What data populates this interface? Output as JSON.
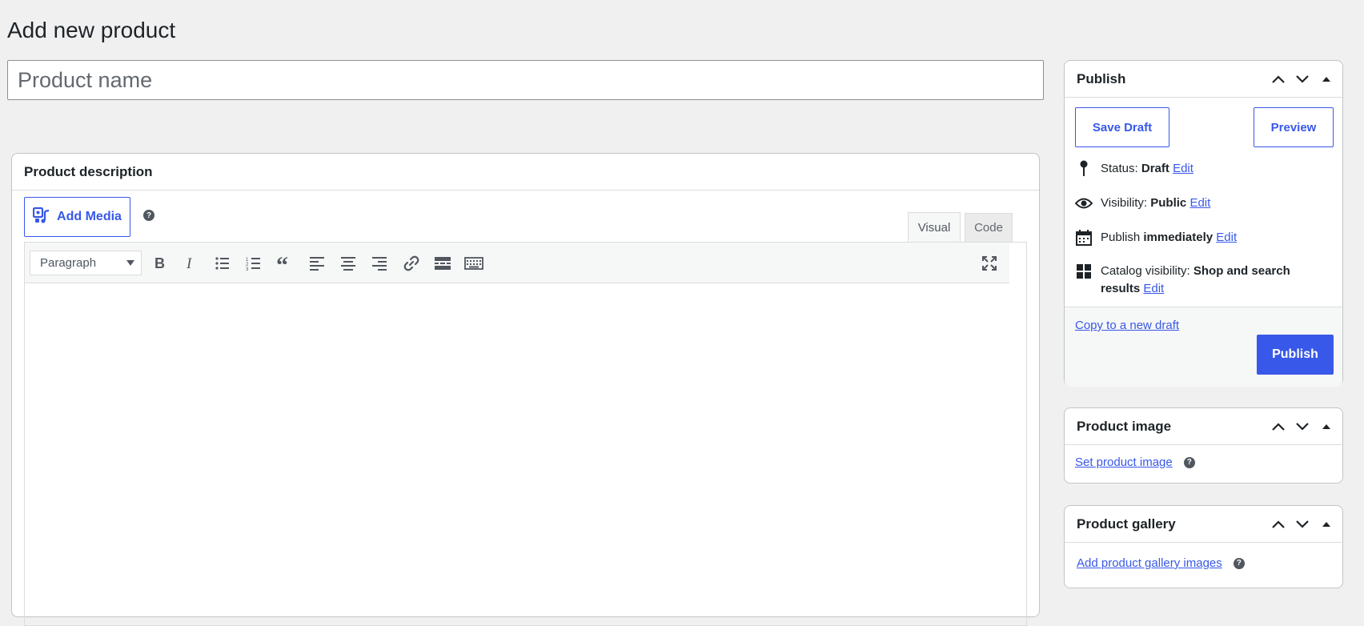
{
  "page": {
    "title": "Add new product"
  },
  "product_name": {
    "placeholder": "Product name",
    "value": ""
  },
  "description": {
    "heading": "Product description",
    "add_media_label": "Add Media",
    "tabs": [
      {
        "label": "Visual",
        "active": true
      },
      {
        "label": "Code",
        "active": false
      }
    ],
    "format_select": "Paragraph",
    "toolbar_icons": [
      "bold-icon",
      "italic-icon",
      "bullet-list-icon",
      "numbered-list-icon",
      "blockquote-icon",
      "align-left-icon",
      "align-center-icon",
      "align-right-icon",
      "link-icon",
      "read-more-icon",
      "toolbar-toggle-icon",
      "fullscreen-icon"
    ]
  },
  "publish": {
    "heading": "Publish",
    "save_draft": "Save Draft",
    "preview": "Preview",
    "status": {
      "label": "Status:",
      "value": "Draft",
      "edit": "Edit"
    },
    "visibility": {
      "label": "Visibility:",
      "value": "Public",
      "edit": "Edit"
    },
    "schedule": {
      "label": "Publish",
      "value": "immediately",
      "edit": "Edit"
    },
    "catalog": {
      "label": "Catalog visibility:",
      "value": "Shop and search results",
      "edit": "Edit"
    },
    "copy_draft": "Copy to a new draft",
    "publish_button": "Publish"
  },
  "product_image": {
    "heading": "Product image",
    "link": "Set product image"
  },
  "product_gallery": {
    "heading": "Product gallery",
    "link": "Add product gallery images"
  },
  "colors": {
    "accent": "#3858e9",
    "background": "#f0f0f1",
    "border": "#c3c4c7"
  }
}
